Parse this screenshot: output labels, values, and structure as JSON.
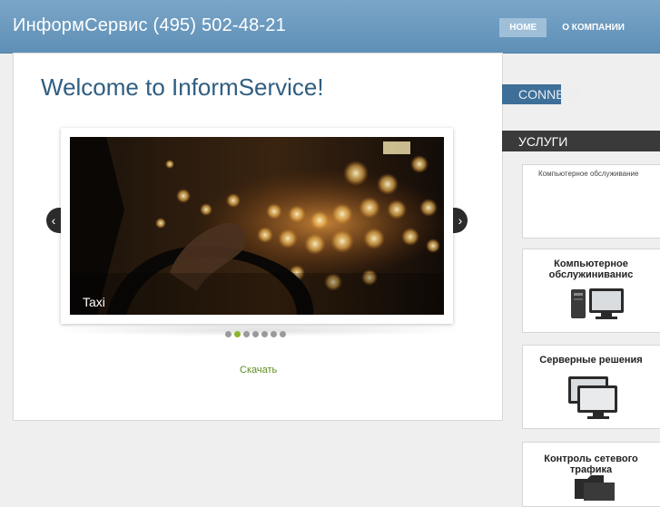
{
  "header": {
    "site_title": "ИнформСервис (495) 502-48-21",
    "nav": [
      {
        "label": "HOME",
        "active": true
      },
      {
        "label": "О КОМПАНИИ",
        "active": false
      }
    ]
  },
  "main": {
    "title": "Welcome to InformService!",
    "slider": {
      "caption": "Taxi",
      "prev_icon": "chevron-left-icon",
      "next_icon": "chevron-right-icon",
      "prev_glyph": "‹",
      "next_glyph": "›",
      "dot_count": 7,
      "active_dot": 1
    },
    "download_label": "Скачать"
  },
  "sidebar": {
    "connect_label": "CONNECT",
    "services_label": "УСЛУГИ",
    "cards": [
      {
        "title": "Компьютерное обслуживание",
        "icon": null
      },
      {
        "title_lines": [
          "Компьютерное",
          "обслужиниванис"
        ],
        "icon": "computer-icon"
      },
      {
        "title_lines": [
          "Серверные решения"
        ],
        "icon": "server-icon"
      },
      {
        "title_lines": [
          "Контроль сетевого",
          "трафика"
        ],
        "icon": "folder-icon"
      }
    ]
  },
  "colors": {
    "header_bg": "#6b98bd",
    "title_blue": "#2f5e82",
    "accent_green": "#8ab42d",
    "link_green": "#5d8d20"
  }
}
